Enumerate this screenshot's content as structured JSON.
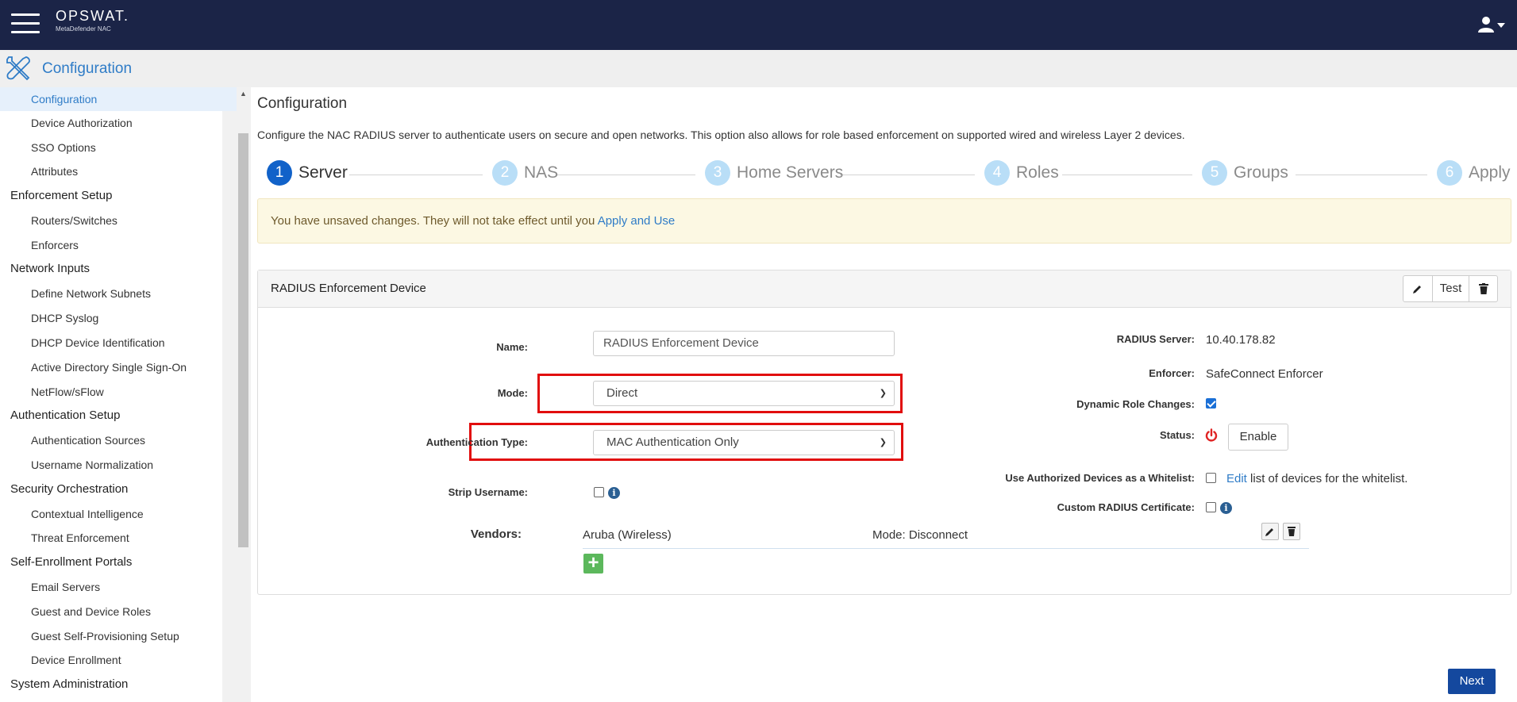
{
  "header": {
    "logo": "OPSWAT.",
    "product": "MetaDefender NAC",
    "section_title": "Configuration"
  },
  "sidebar": {
    "items": [
      {
        "label": "Configuration",
        "kind": "sub",
        "active": true
      },
      {
        "label": "Device Authorization",
        "kind": "sub"
      },
      {
        "label": "SSO Options",
        "kind": "sub"
      },
      {
        "label": "Attributes",
        "kind": "sub"
      },
      {
        "label": "Enforcement Setup",
        "kind": "head"
      },
      {
        "label": "Routers/Switches",
        "kind": "sub"
      },
      {
        "label": "Enforcers",
        "kind": "sub"
      },
      {
        "label": "Network Inputs",
        "kind": "head"
      },
      {
        "label": "Define Network Subnets",
        "kind": "sub"
      },
      {
        "label": "DHCP Syslog",
        "kind": "sub"
      },
      {
        "label": "DHCP Device Identification",
        "kind": "sub"
      },
      {
        "label": "Active Directory Single Sign-On",
        "kind": "sub"
      },
      {
        "label": "NetFlow/sFlow",
        "kind": "sub"
      },
      {
        "label": "Authentication Setup",
        "kind": "head"
      },
      {
        "label": "Authentication Sources",
        "kind": "sub"
      },
      {
        "label": "Username Normalization",
        "kind": "sub"
      },
      {
        "label": "Security Orchestration",
        "kind": "head"
      },
      {
        "label": "Contextual Intelligence",
        "kind": "sub"
      },
      {
        "label": "Threat Enforcement",
        "kind": "sub"
      },
      {
        "label": "Self-Enrollment Portals",
        "kind": "head"
      },
      {
        "label": "Email Servers",
        "kind": "sub"
      },
      {
        "label": "Guest and Device Roles",
        "kind": "sub"
      },
      {
        "label": "Guest Self-Provisioning Setup",
        "kind": "sub"
      },
      {
        "label": "Device Enrollment",
        "kind": "sub"
      },
      {
        "label": "System Administration",
        "kind": "head"
      }
    ]
  },
  "main": {
    "title": "Configuration",
    "description": "Configure the NAC RADIUS server to authenticate users on secure and open networks. This option also allows for role based enforcement on supported wired and wireless Layer 2 devices.",
    "steps": [
      {
        "num": "1",
        "label": "Server",
        "active": true
      },
      {
        "num": "2",
        "label": "NAS"
      },
      {
        "num": "3",
        "label": "Home Servers"
      },
      {
        "num": "4",
        "label": "Roles"
      },
      {
        "num": "5",
        "label": "Groups"
      },
      {
        "num": "6",
        "label": "Apply"
      }
    ],
    "alert": {
      "text": "You have unsaved changes. They will not take effect until you",
      "link": "Apply and Use"
    },
    "panel": {
      "title": "RADIUS Enforcement Device",
      "test_label": "Test",
      "form": {
        "name_label": "Name:",
        "name_value": "RADIUS Enforcement Device",
        "mode_label": "Mode:",
        "mode_value": "Direct",
        "auth_type_label": "Authentication Type:",
        "auth_type_value": "MAC Authentication Only",
        "strip_username_label": "Strip Username:",
        "strip_username_checked": false,
        "vendors_label": "Vendors:",
        "vendor_name": "Aruba (Wireless)",
        "vendor_mode": "Mode: Disconnect"
      },
      "info": {
        "radius_server_label": "RADIUS Server:",
        "radius_server_value": "10.40.178.82",
        "enforcer_label": "Enforcer:",
        "enforcer_value": "SafeConnect Enforcer",
        "dynamic_role_label": "Dynamic Role Changes:",
        "dynamic_role_checked": true,
        "status_label": "Status:",
        "enable_label": "Enable",
        "whitelist_label": "Use Authorized Devices as a Whitelist:",
        "whitelist_checked": false,
        "whitelist_edit": "Edit",
        "whitelist_text": "list of devices for the whitelist.",
        "custom_cert_label": "Custom RADIUS Certificate:",
        "custom_cert_checked": false
      }
    },
    "next_label": "Next"
  },
  "colors": {
    "topbar": "#1b2447",
    "accent": "#2f7cc7",
    "step_active": "#1162c9",
    "step_inactive": "#b9def7",
    "highlight_box": "#e10d0d",
    "next_button": "#14489e",
    "add_button": "#5cb85c",
    "power_icon": "#e02424"
  }
}
